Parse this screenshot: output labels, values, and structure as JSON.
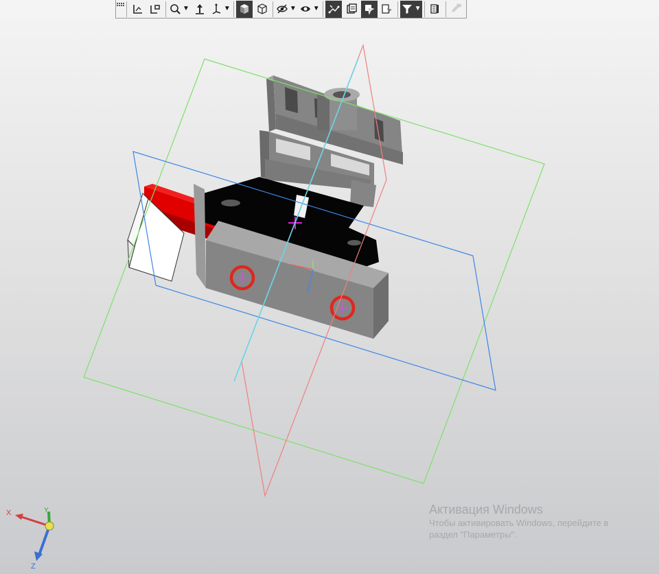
{
  "toolbar": {
    "buttons": [
      {
        "icon": "grip-icon"
      },
      {
        "icon": "coordinate-system-icon"
      },
      {
        "icon": "orientation-icon"
      },
      {
        "icon": "zoom-icon",
        "dropdown": true
      },
      {
        "icon": "pan-icon"
      },
      {
        "icon": "rotate-view-icon",
        "dropdown": true
      },
      {
        "icon": "shaded-cube-icon",
        "active": true
      },
      {
        "icon": "wireframe-cube-icon"
      },
      {
        "icon": "hide-icon",
        "dropdown": true
      },
      {
        "icon": "show-icon",
        "dropdown": true
      },
      {
        "icon": "constraints-icon",
        "active": true
      },
      {
        "icon": "layers-icon"
      },
      {
        "icon": "display-mode-icon",
        "active": true
      },
      {
        "icon": "filter-panel-icon"
      },
      {
        "icon": "filter-icon",
        "active": true,
        "dropdown": true
      },
      {
        "icon": "properties-icon"
      },
      {
        "icon": "eyedropper-icon",
        "disabled": true
      }
    ]
  },
  "axes": {
    "x_label": "X",
    "y_label": "Y",
    "z_label": "Z",
    "x_color": "#d04040",
    "y_color": "#3aa63a",
    "z_color": "#3a6fd0"
  },
  "planes": {
    "green_color": "#7ee06a",
    "blue_color": "#3c86e6",
    "red_color": "#f07f7f"
  },
  "parts": {
    "highlight_color": "#e00000",
    "grey_color": "#858585",
    "dark_color": "#050505",
    "marker_color": "#e0261d"
  },
  "watermark": {
    "title": "Активация Windows",
    "line1": "Чтобы активировать Windows, перейдите в",
    "line2": "раздел \"Параметры\"."
  }
}
